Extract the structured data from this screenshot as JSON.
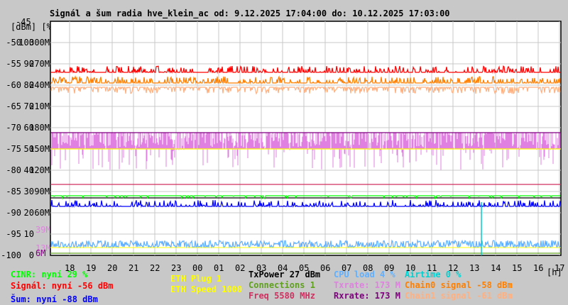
{
  "chart_data": {
    "type": "line",
    "title": "Signál a šum radia hve_klein_ac od: 9.12.2025 17:04:00 do: 10.12.2025 17:03:00",
    "ylabel": "[dBm] [%]",
    "xlabel": "[h]",
    "y_top_label": "-45",
    "ylim_dbm": [
      -100,
      -45
    ],
    "ylim_pct": [
      0,
      100
    ],
    "ylim_rate_M": [
      0,
      300
    ],
    "y_ticks": [
      {
        "dbm": "-50",
        "pct": "100",
        "rate": "300M"
      },
      {
        "dbm": "-55",
        "pct": "90",
        "rate": "270M"
      },
      {
        "dbm": "-60",
        "pct": "80",
        "rate": "240M"
      },
      {
        "dbm": "-65",
        "pct": "70",
        "rate": "210M"
      },
      {
        "dbm": "-70",
        "pct": "60",
        "rate": "180M"
      },
      {
        "dbm": "-75",
        "pct": "50",
        "rate": "150M"
      },
      {
        "dbm": "-80",
        "pct": "40",
        "rate": "120M"
      },
      {
        "dbm": "-85",
        "pct": "30",
        "rate": "90M"
      },
      {
        "dbm": "-90",
        "pct": "20",
        "rate": "60M"
      },
      {
        "dbm": "-95",
        "pct": "10",
        "rate": ""
      },
      {
        "dbm": "-100",
        "pct": "0",
        "rate": ""
      }
    ],
    "extra_rate_labels": [
      "39M",
      "13M",
      "6M"
    ],
    "x_ticks": [
      "18",
      "19",
      "20",
      "21",
      "22",
      "23",
      "00",
      "01",
      "02",
      "03",
      "04",
      "05",
      "06",
      "07",
      "08",
      "09",
      "10",
      "11",
      "12",
      "13",
      "14",
      "15",
      "16",
      "17"
    ],
    "series": [
      {
        "name": "Signál",
        "unit": "dBm",
        "base": -57,
        "current": -56,
        "color": "#ff0000"
      },
      {
        "name": "Chain0 signal",
        "unit": "dBm",
        "base": -59.5,
        "current": -58,
        "color": "#ff7f00"
      },
      {
        "name": "Chain1 signal",
        "unit": "dBm",
        "base": -60.5,
        "current": -61,
        "color": "#ffb080"
      },
      {
        "name": "Šum",
        "unit": "dBm",
        "base": -88.5,
        "current": -88,
        "color": "#0000ff"
      },
      {
        "name": "CINR",
        "unit": "%",
        "base": 28,
        "current": 29,
        "color": "#00ff00"
      },
      {
        "name": "Txrate",
        "unit": "M",
        "base": 150,
        "current": 173,
        "color": "#e080e0"
      },
      {
        "name": "Rxrate",
        "unit": "M",
        "base": 173,
        "current": 173,
        "color": "#800080"
      },
      {
        "name": "Freq",
        "unit": "MHz",
        "current": 5580,
        "color": "#d03060"
      },
      {
        "name": "TxPower",
        "unit": "dBm",
        "current": 27,
        "color": "#000000"
      },
      {
        "name": "CPU load",
        "unit": "%",
        "base": 4,
        "current": 4,
        "color": "#60b0ff"
      },
      {
        "name": "Airtime",
        "unit": "%",
        "current": 0,
        "color": "#00d0d0"
      },
      {
        "name": "Connections",
        "current": 1,
        "color": "#60a020"
      },
      {
        "name": "ETH Speed",
        "current": 1000,
        "color": "#ffff00"
      }
    ]
  },
  "legend": {
    "cinr": "CINR: nyní 29 %",
    "signal": "Signál: nyní -56 dBm",
    "noise": "Šum: nyní -88 dBm",
    "eth_plug": "ETH Plug 1",
    "eth_speed": "ETH Speed 1000",
    "txpower": "TxPower 27 dBm",
    "connections": "Connections 1",
    "freq": "Freq 5580 MHz",
    "cpu": "CPU load 4 %",
    "txrate": "Txrate: 173 M",
    "rxrate": "Rxrate: 173 M",
    "airtime": "Airtime 0 %",
    "chain0": "Chain0 signal -58 dBm",
    "chain1": "Chain1 signal -61 dBm"
  }
}
